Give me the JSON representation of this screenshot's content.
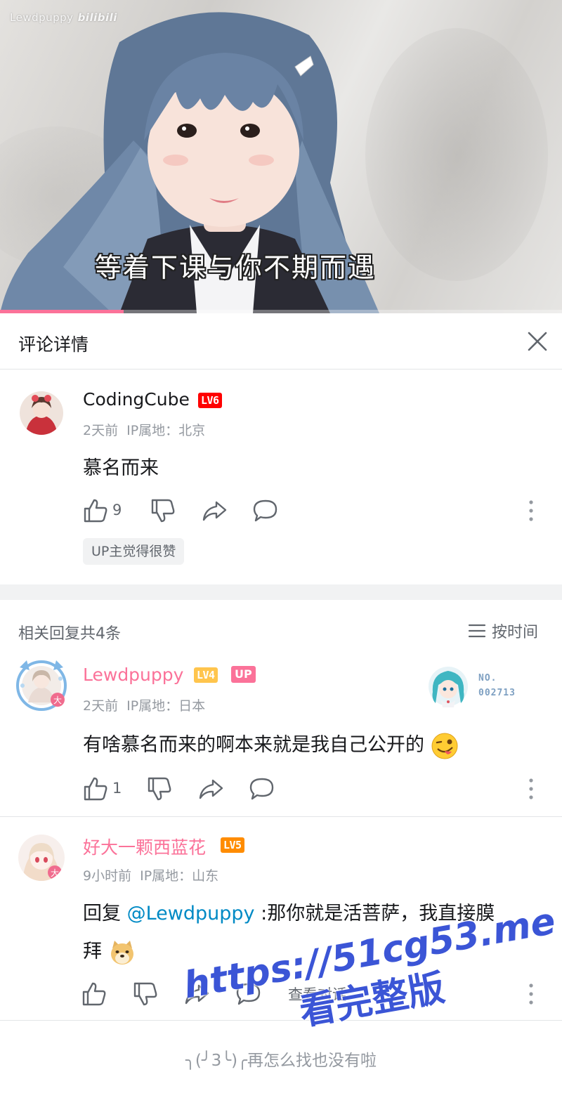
{
  "video": {
    "watermark_text": "Lewdpuppy",
    "watermark_brand": "bilibili",
    "subtitle": "等着下课与你不期而遇",
    "progress_fraction": 0.22
  },
  "panel": {
    "title": "评论详情"
  },
  "root_comment": {
    "username": "CodingCube",
    "level": "LV6",
    "time": "2天前",
    "ip": "IP属地：北京",
    "text": "慕名而来",
    "like_count": "9",
    "up_liked_tag": "UP主觉得很赞"
  },
  "replies_header": {
    "title": "相关回复共4条",
    "sort_label": "按时间"
  },
  "replies": [
    {
      "username": "Lewdpuppy",
      "level": "LV4",
      "badge": "UP",
      "time": "2天前",
      "ip": "IP属地：日本",
      "text": "有啥慕名而来的啊本来就是我自己公开的",
      "emoji": "wink-tongue-emoji",
      "like_count": "1",
      "fan_medal_prefix": "NO.",
      "fan_medal_number": "002713"
    },
    {
      "username": "好大一颗西蓝花",
      "level": "LV5",
      "time": "9小时前",
      "ip": "IP属地：山东",
      "reply_prefix": "回复 ",
      "mention": "@Lewdpuppy",
      "text_line1": " :那你就是活菩萨，我直接膜",
      "text_line2": "拜",
      "emoji": "doge-emoji",
      "view_conversation": "查看对话"
    }
  ],
  "footer": {
    "end_text": "╮(╯3╰)╭再怎么找也没有啦"
  },
  "overlay_watermark": {
    "url": "https://51cg53.me",
    "subtitle": "看完整版"
  },
  "colors": {
    "accent_pink": "#fb7299",
    "lv4": "#ffc54d",
    "lv5": "#ff8c00",
    "lv6": "#ff0000",
    "mention_blue": "#008ac5",
    "promo_blue": "#3b55d6"
  }
}
